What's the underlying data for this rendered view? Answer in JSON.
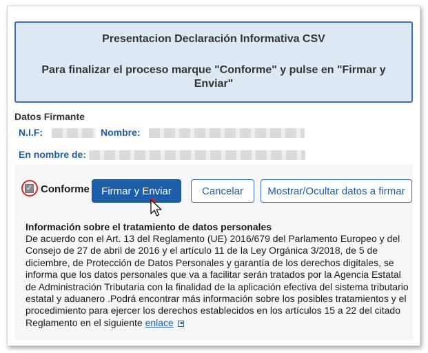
{
  "header": {
    "title": "Presentacion Declaración Informativa CSV",
    "instruction": "Para finalizar el proceso marque \"Conforme\" y pulse en \"Firmar y Enviar\""
  },
  "datos_firmante": {
    "title": "Datos Firmante",
    "nif_label": "N.I.F:",
    "nombre_label": "Nombre:",
    "en_nombre_label": "En nombre de:"
  },
  "actions": {
    "conforme_checked": true,
    "conforme_label": "Conforme",
    "sign_button": "Firmar y Enviar",
    "cancel_button": "Cancelar",
    "toggle_button": "Mostrar/Ocultar datos a firmar"
  },
  "info": {
    "title": "Información sobre el tratamiento de datos personales",
    "body": "De acuerdo con el Art. 13 del Reglamento (UE) 2016/679 del Parlamento Europeo y del Consejo de 27 de abril de 2016 y el artículo 11 de la Ley Orgánica 3/2018, de 5 de diciembre, de Protección de Datos Personales y garantía de los derechos digitales, se informa que los datos personales que va a facilitar serán tratados por la Agencia Estatal de Administración Tributaria con la finalidad de la aplicación efectiva del sistema tributario estatal y aduanero .Podrá encontrar más información sobre los posibles tratamientos y el procedimiento para ejercer los derechos establecidos en los artículos 15 a 22 del citado Reglamento en el siguiente ",
    "link_text": "enlace"
  },
  "icons": {
    "checkbox": "checkmark-icon",
    "cursor": "mouse-pointer-icon",
    "external": "external-link-icon"
  },
  "colors": {
    "primary": "#1c5fa8",
    "header_bg": "#dce8f3",
    "header_border": "#3b6fb6",
    "label_blue": "#1f5ba6",
    "highlight_circle": "#d62626"
  }
}
